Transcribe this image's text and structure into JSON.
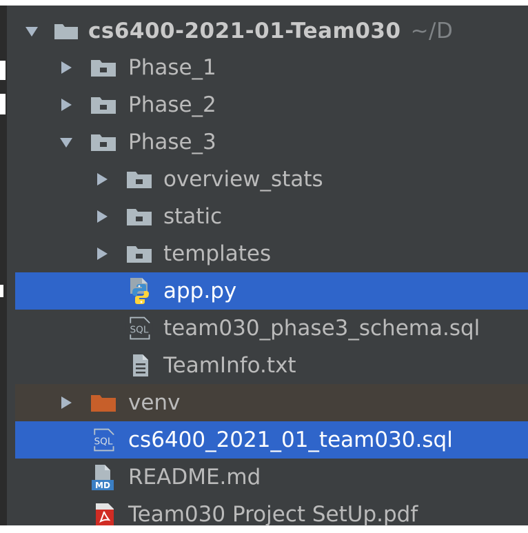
{
  "project_tree": {
    "root": {
      "name": "cs6400-2021-01-Team030",
      "path_hint": "~/D",
      "expanded": true,
      "icon": "folder-icon"
    },
    "rows": [
      {
        "label": "Phase_1",
        "type": "folder",
        "expanded": false,
        "icon": "folder-icon"
      },
      {
        "label": "Phase_2",
        "type": "folder",
        "expanded": false,
        "icon": "folder-icon"
      },
      {
        "label": "Phase_3",
        "type": "folder",
        "expanded": true,
        "icon": "folder-icon"
      },
      {
        "label": "overview_stats",
        "type": "folder",
        "expanded": false,
        "icon": "folder-icon"
      },
      {
        "label": "static",
        "type": "folder",
        "expanded": false,
        "icon": "folder-icon"
      },
      {
        "label": "templates",
        "type": "folder",
        "expanded": false,
        "icon": "folder-icon"
      },
      {
        "label": "app.py",
        "type": "python-file",
        "selected": true,
        "icon": "python-file-icon"
      },
      {
        "label": "team030_phase3_schema.sql",
        "type": "sql-file",
        "icon": "sql-file-icon",
        "icon_text": "SQL"
      },
      {
        "label": "TeamInfo.txt",
        "type": "text-file",
        "icon": "text-file-icon"
      },
      {
        "label": "venv",
        "type": "excluded-folder",
        "expanded": false,
        "icon": "excluded-folder-icon"
      },
      {
        "label": "cs6400_2021_01_team030.sql",
        "type": "sql-file",
        "selected": true,
        "icon": "sql-file-icon",
        "icon_text": "SQL"
      },
      {
        "label": "README.md",
        "type": "markdown-file",
        "icon": "markdown-file-icon",
        "icon_text": "MD"
      },
      {
        "label": "Team030 Project SetUp.pdf",
        "type": "pdf-file",
        "icon": "pdf-file-icon"
      }
    ]
  },
  "colors": {
    "panel_background": "#3c3f41",
    "text": "#bbbbbb",
    "selection": "#2f65ca",
    "excluded_row": "#45403a",
    "folder": "#aeb9c0",
    "excluded_folder": "#c75f2a"
  }
}
